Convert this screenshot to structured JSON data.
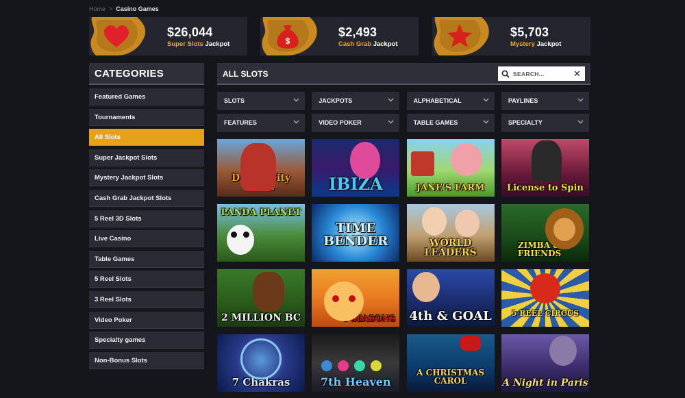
{
  "breadcrumb": {
    "home": "Home",
    "separator": ">",
    "current": "Casino Games"
  },
  "jackpots": [
    {
      "amount": "$26,044",
      "highlight": "Super Slots",
      "suffix": "Jackpot",
      "icon": "heart-icon",
      "icon_color": "#e0202a"
    },
    {
      "amount": "$2,493",
      "highlight": "Cash Grab",
      "suffix": "Jackpot",
      "icon": "money-bag-icon",
      "icon_color": "#d8201c"
    },
    {
      "amount": "$5,703",
      "highlight": "Mystery",
      "suffix": "Jackpot",
      "icon": "star-icon",
      "icon_color": "#d8201c"
    }
  ],
  "categories": {
    "title": "CATEGORIES",
    "items": [
      "Featured Games",
      "Tournaments",
      "All Slots",
      "Super Jackpot Slots",
      "Mystery Jackpot Slots",
      "Cash Grab Jackpot Slots",
      "5 Reel 3D Slots",
      "Live Casino",
      "Table Games",
      "5 Reel Slots",
      "3 Reel Slots",
      "Video Poker",
      "Specialty games",
      "Non-Bonus Slots"
    ],
    "active": "All Slots"
  },
  "main": {
    "title": "ALL SLOTS",
    "search_placeholder": "SEARCH...",
    "filters": [
      "SLOTS",
      "JACKPOTS",
      "ALPHABETICAL",
      "PAYLINES",
      "FEATURES",
      "VIDEO POKER",
      "TABLE GAMES",
      "SPECIALTY"
    ]
  },
  "games": [
    "Dodge City Slots",
    "IBIZA",
    "JANE'S FARM",
    "License to Spin",
    "PANDA PLANET",
    "TIME BENDER",
    "WORLD LEADERS",
    "ZIMBA & FRIENDS",
    "2 MILLION BC",
    "4 SEASONS",
    "4th & GOAL",
    "5 REEL CIRCUS",
    "7 Chakras",
    "7th Heaven",
    "A CHRISTMAS CAROL",
    "A Night in Paris"
  ],
  "colors": {
    "accent": "#e3a21a",
    "jackpot_label": "#f0a820",
    "background": "#15151c",
    "panel": "#2b2b35"
  }
}
